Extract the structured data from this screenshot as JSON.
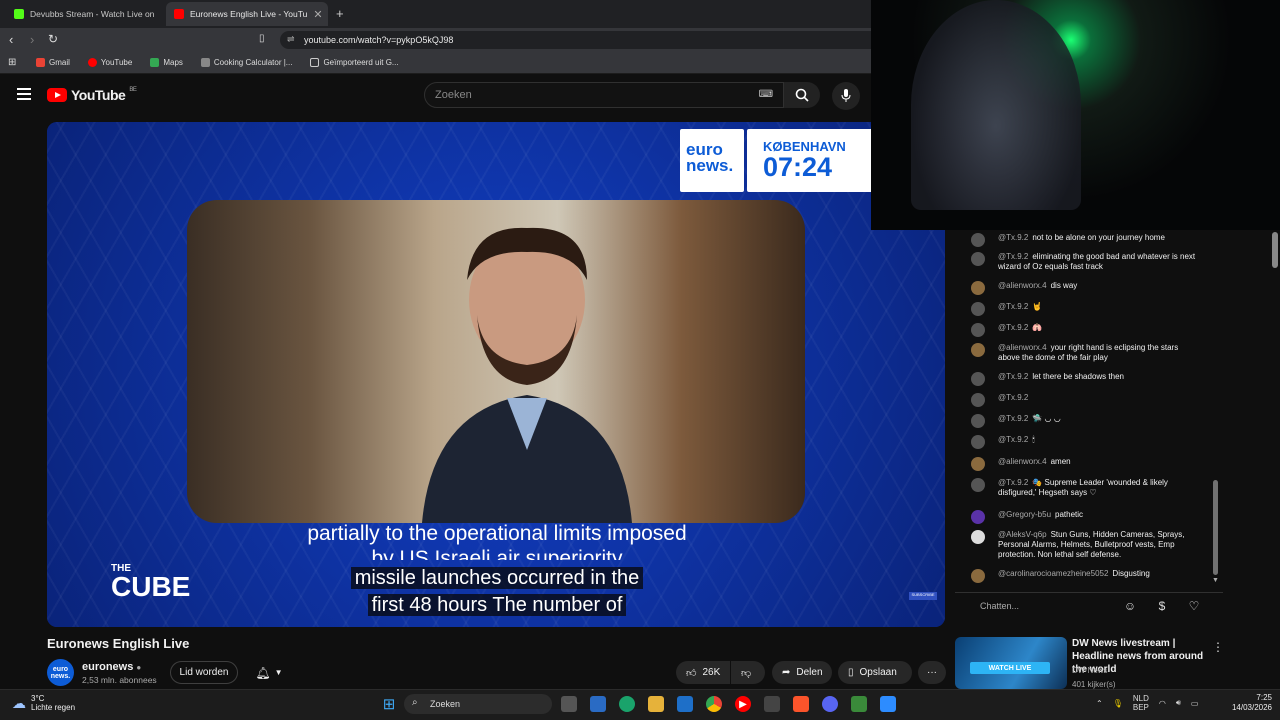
{
  "browser": {
    "tabs": [
      {
        "label": "Devubbs Stream - Watch Live on",
        "color": "#53fc18"
      },
      {
        "label": "Euronews English Live - YouTu",
        "color": "#ff0000"
      }
    ],
    "url": "youtube.com/watch?v=pykpO5kQJ98",
    "bookmarks": [
      "Gmail",
      "YouTube",
      "Maps",
      "Cooking Calculator |...",
      "Geïmporteerd uit G..."
    ]
  },
  "youtube": {
    "logo_text": "YouTube",
    "country_code": "BE",
    "search_placeholder": "Zoeken"
  },
  "video": {
    "euronews_logo_line1": "euro",
    "euronews_logo_line2": "news.",
    "city": "KØBENHAVN",
    "time": "07:24",
    "caption_upper": "partially to the operational limits imposed",
    "caption_upper_cut": "by US Israeli air superiority",
    "caption_line1": "missile launches occurred in the",
    "caption_line2": "first 48 hours The number of",
    "cube_top": "THE",
    "cube_word": "CUBE",
    "subscribe_mini": "SUBSCRIBE"
  },
  "chat": {
    "messages": [
      {
        "author": "@Tx.9.2",
        "text": "not to be alone on your journey home"
      },
      {
        "author": "@Tx.9.2",
        "text": "eliminating the good bad and whatever is next wizard of Oz equals fast track"
      },
      {
        "author": "@alienworx.4",
        "text": "dis way"
      },
      {
        "author": "@Tx.9.2",
        "text": "🤘"
      },
      {
        "author": "@Tx.9.2",
        "text": "🫁"
      },
      {
        "author": "@alienworx.4",
        "text": "your right hand is eclipsing the stars above the dome of the fair play"
      },
      {
        "author": "@Tx.9.2",
        "text": "let there be shadows then"
      },
      {
        "author": "@Tx.9.2",
        "text": ""
      },
      {
        "author": "@Tx.9.2",
        "text": "🛸 ◡ ◡"
      },
      {
        "author": "@Tx.9.2",
        "text": "🕯"
      },
      {
        "author": "@alienworx.4",
        "text": "amen"
      },
      {
        "author": "@Tx.9.2",
        "text": "🎭 Supreme Leader 'wounded & likely disfigured,' Hegseth says ♡"
      },
      {
        "author": "@Gregory-b5u",
        "text": "pathetic"
      },
      {
        "author": "@AleksV-q6p",
        "text": "Stun Guns, Hidden Cameras, Sprays, Personal Alarms, Helmets, Bulletproof vests, Emp protection. Non lethal self defense."
      },
      {
        "author": "@carolinarocioamezheine5052",
        "text": "Disgusting"
      }
    ],
    "input_placeholder": "Chatten..."
  },
  "below_video": {
    "title": "Euronews English Live",
    "channel": "euronews",
    "channel_avatar": "euro news.",
    "subscribers": "2,53 mln. abonnees",
    "join_label": "Lid worden",
    "likes": "26K",
    "share_label": "Delen",
    "save_label": "Opslaan"
  },
  "recommendation": {
    "title": "DW News livestream | Headline news from around the world",
    "badge": "WATCH LIVE",
    "channel": "DW News",
    "viewers": "401 kijker(s)"
  },
  "taskbar": {
    "temperature": "3°C",
    "weather": "Lichte regen",
    "search_label": "Zoeken",
    "lang_line1": "NLD",
    "lang_line2": "BEP",
    "time": "7:25",
    "date": "14/03/2026"
  }
}
